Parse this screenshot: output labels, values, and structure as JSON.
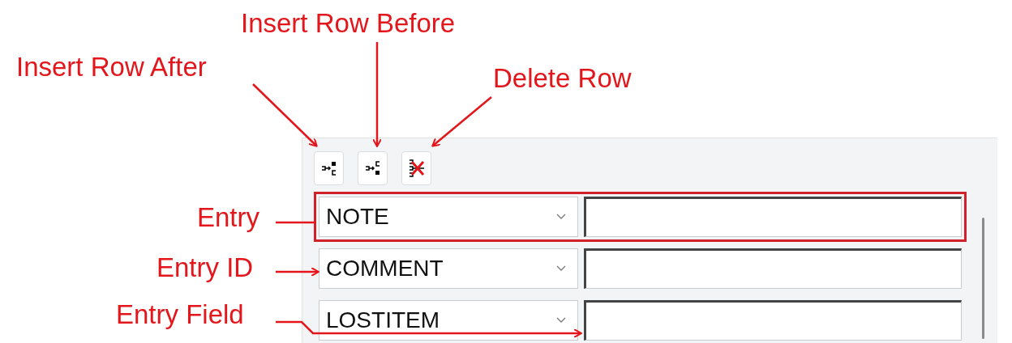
{
  "annotations": [
    {
      "text": "Insert Row After"
    },
    {
      "text": "Insert Row Before"
    },
    {
      "text": "Delete Row"
    },
    {
      "text": "Entry"
    },
    {
      "text": "Entry ID"
    },
    {
      "text": "Entry Field"
    }
  ],
  "toolbar": [
    {
      "kind": "insert_after"
    },
    {
      "kind": "insert_before"
    },
    {
      "kind": "delete"
    }
  ],
  "rows": [
    {
      "entry_id": "NOTE",
      "highlighted": true
    },
    {
      "entry_id": "COMMENT",
      "highlighted": false
    },
    {
      "entry_id": "LOSTITEM",
      "highlighted": false
    }
  ]
}
